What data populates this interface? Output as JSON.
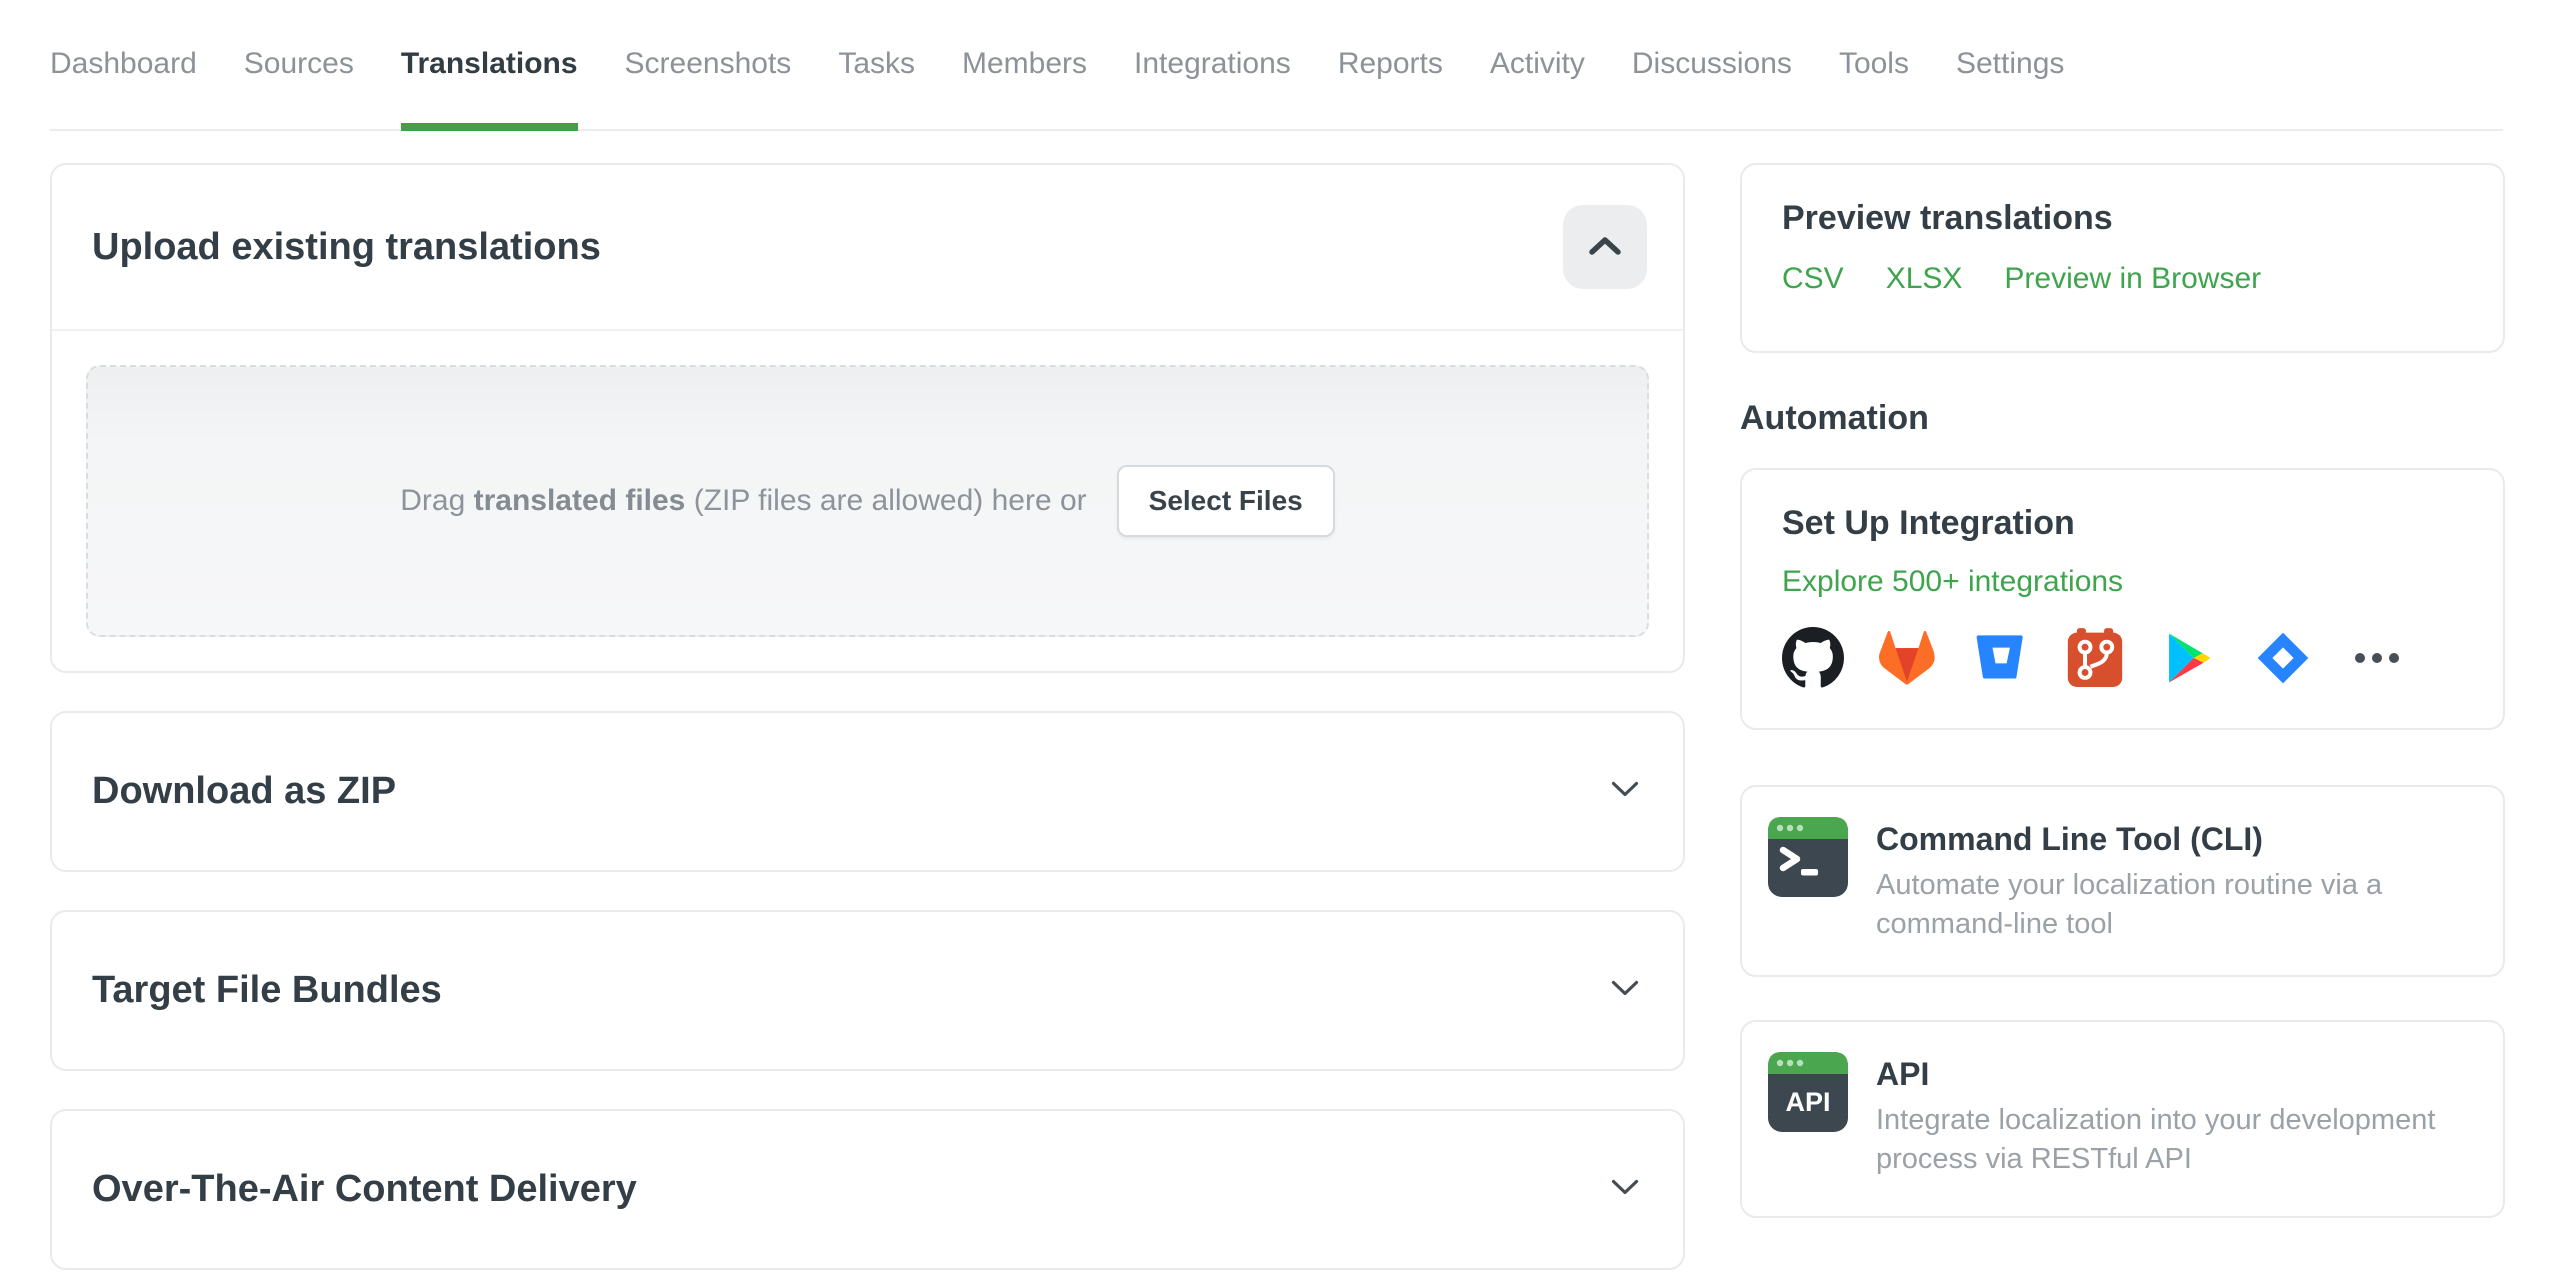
{
  "nav": {
    "items": [
      {
        "label": "Dashboard",
        "active": false
      },
      {
        "label": "Sources",
        "active": false
      },
      {
        "label": "Translations",
        "active": true
      },
      {
        "label": "Screenshots",
        "active": false
      },
      {
        "label": "Tasks",
        "active": false
      },
      {
        "label": "Members",
        "active": false
      },
      {
        "label": "Integrations",
        "active": false
      },
      {
        "label": "Reports",
        "active": false
      },
      {
        "label": "Activity",
        "active": false
      },
      {
        "label": "Discussions",
        "active": false
      },
      {
        "label": "Tools",
        "active": false
      },
      {
        "label": "Settings",
        "active": false
      }
    ]
  },
  "upload_card": {
    "title": "Upload existing translations",
    "collapse_icon": "chevron-up-icon",
    "dropzone": {
      "drag_prefix": "Drag ",
      "drag_bold": "translated files",
      "drag_suffix": " (ZIP files are allowed) here or",
      "select_button": "Select Files"
    }
  },
  "accordions": [
    {
      "title": "Download as ZIP",
      "state": "collapsed"
    },
    {
      "title": "Target File Bundles",
      "state": "collapsed"
    },
    {
      "title": "Over-The-Air Content Delivery",
      "state": "collapsed"
    }
  ],
  "preview": {
    "title": "Preview translations",
    "links": [
      "CSV",
      "XLSX",
      "Preview in Browser"
    ]
  },
  "automation": {
    "heading": "Automation",
    "integration": {
      "title": "Set Up Integration",
      "link": "Explore 500+ integrations",
      "icons": [
        "github-icon",
        "gitlab-icon",
        "bitbucket-icon",
        "git-icon",
        "google-play-icon",
        "jira-icon",
        "more-integrations-icon"
      ]
    },
    "cli": {
      "title": "Command Line Tool (CLI)",
      "desc_line1": "Automate your localization routine via a",
      "desc_line2": "command-line tool"
    },
    "api": {
      "title": "API",
      "desc_line1": "Integrate localization into your development",
      "desc_line2": "process via RESTful API"
    }
  },
  "colors": {
    "accent_green": "#3fa44e",
    "underline_green": "#43a047",
    "heading_dark": "#333e46",
    "nav_gray": "#8c9298"
  }
}
